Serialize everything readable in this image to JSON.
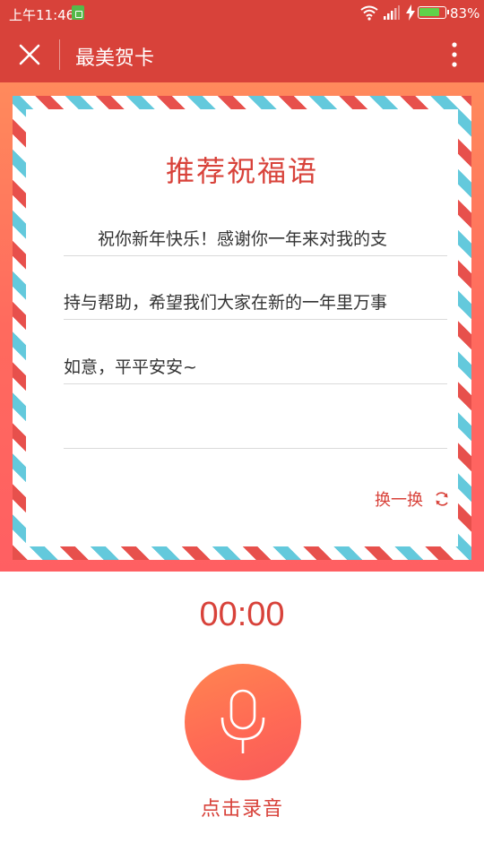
{
  "status_bar": {
    "time": "上午11:46",
    "battery_percent": "83%",
    "battery_level": 0.83,
    "icons": [
      "sim-icon",
      "wifi-icon",
      "signal-icon",
      "charging-bolt-icon",
      "battery-icon"
    ]
  },
  "title_bar": {
    "title": "最美贺卡",
    "close_icon": "close-icon",
    "more_icon": "more-vertical-icon"
  },
  "card": {
    "title": "推荐祝福语",
    "lines": [
      "　　祝你新年快乐！感谢你一年来对我的支",
      "持与帮助，希望我们大家在新的一年里万事",
      "如意，平平安安~",
      ""
    ],
    "refresh_label": "换一换",
    "refresh_icon": "refresh-icon"
  },
  "recorder": {
    "timer": "00:00",
    "record_label": "点击录音",
    "mic_icon": "microphone-icon"
  },
  "colors": {
    "accent": "#d8423a",
    "stage_top": "#ff8a5c",
    "stage_bottom": "#ff5f62",
    "stripe_red": "#e7504c",
    "stripe_blue": "#63c9dc"
  }
}
